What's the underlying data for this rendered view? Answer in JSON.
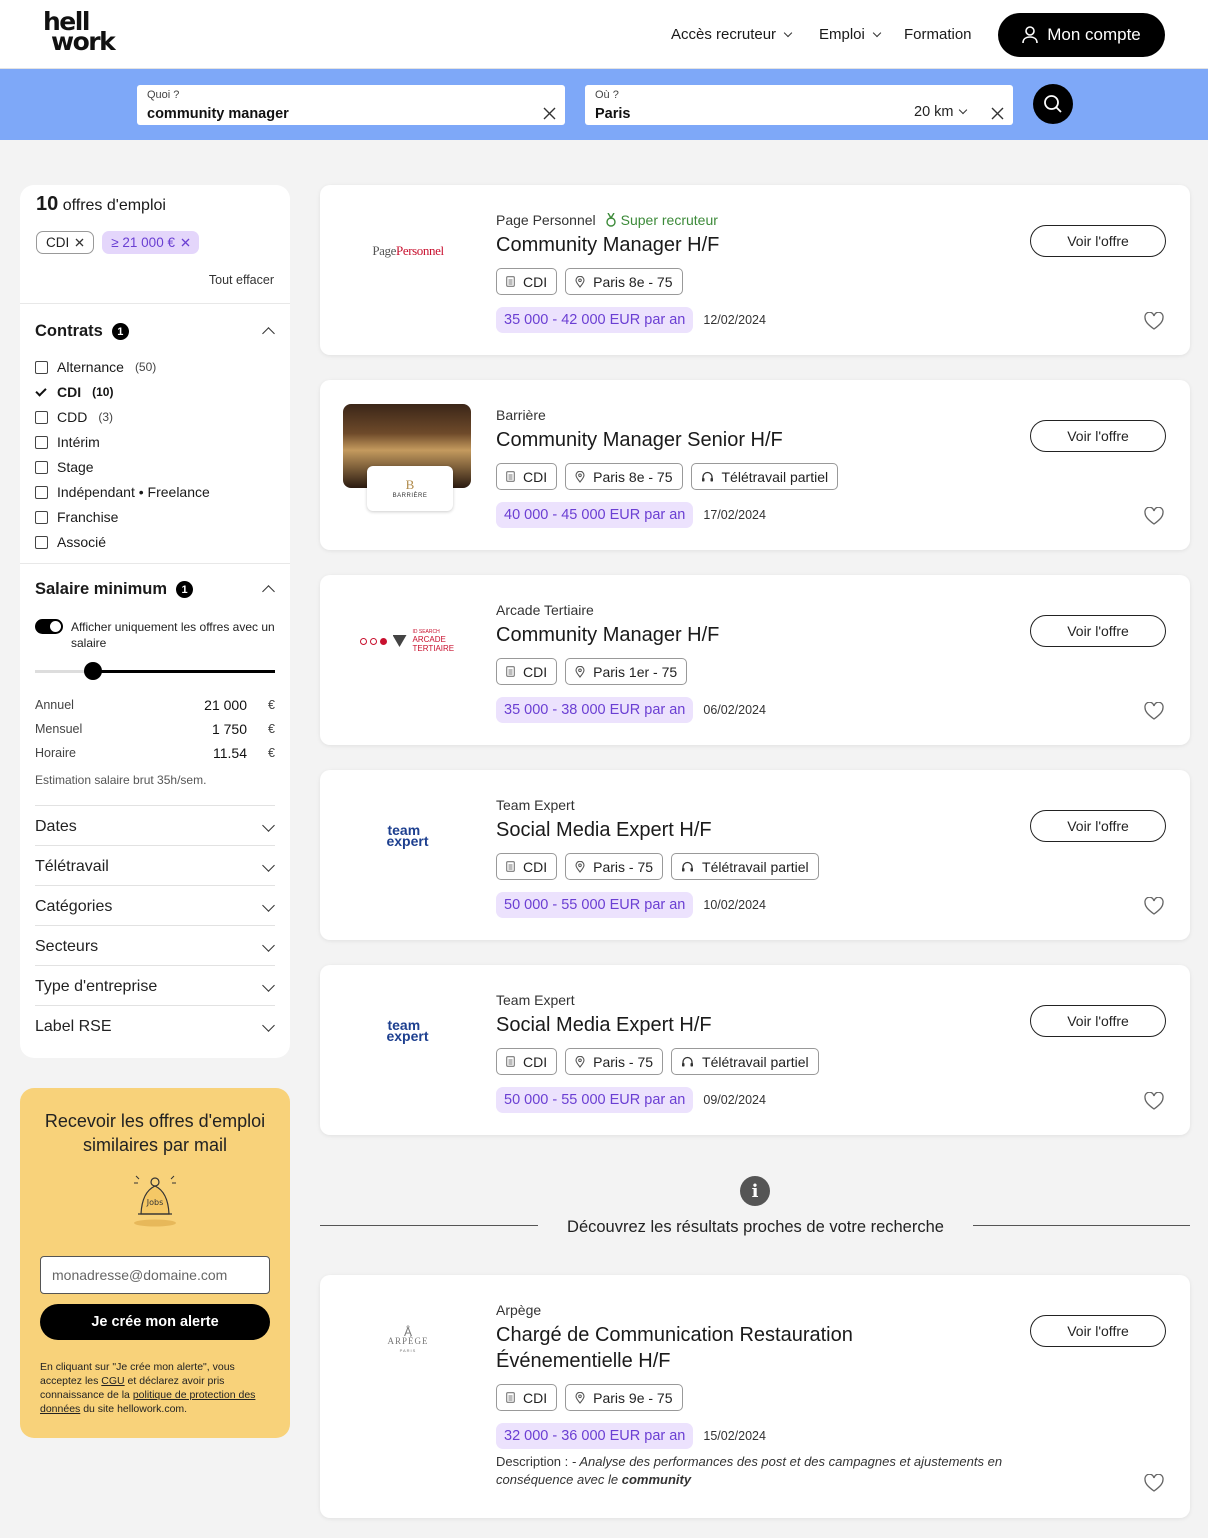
{
  "header": {
    "logo_line1": "hell",
    "logo_line2": "work",
    "nav": [
      {
        "label": "Accès recruteur",
        "dropdown": true
      },
      {
        "label": "Emploi",
        "dropdown": true
      },
      {
        "label": "Formation",
        "dropdown": false
      }
    ],
    "account_label": "Mon compte"
  },
  "search": {
    "what_label": "Quoi ?",
    "what_value": "community manager",
    "where_label": "Où ?",
    "where_value": "Paris",
    "radius": "20 km"
  },
  "sidebar": {
    "count": "10",
    "count_label": "offres d'emploi",
    "chips": [
      "CDI",
      "≥ 21 000 €"
    ],
    "clear_all": "Tout effacer",
    "contracts": {
      "title": "Contrats",
      "badge": "1",
      "options": [
        {
          "label": "Alternance",
          "count": "(50)",
          "checked": false
        },
        {
          "label": "CDI",
          "count": "(10)",
          "checked": true
        },
        {
          "label": "CDD",
          "count": "(3)",
          "checked": false
        },
        {
          "label": "Intérim",
          "count": "",
          "checked": false
        },
        {
          "label": "Stage",
          "count": "",
          "checked": false
        },
        {
          "label": "Indépendant • Freelance",
          "count": "",
          "checked": false
        },
        {
          "label": "Franchise",
          "count": "",
          "checked": false
        },
        {
          "label": "Associé",
          "count": "",
          "checked": false
        }
      ]
    },
    "salary": {
      "title": "Salaire minimum",
      "badge": "1",
      "toggle_label": "Afficher uniquement les offres avec un salaire",
      "toggle_on": true,
      "slider_level": 0.24,
      "rows": [
        {
          "label": "Annuel",
          "value": "21 000",
          "currency": "€"
        },
        {
          "label": "Mensuel",
          "value": "1 750",
          "currency": "€"
        },
        {
          "label": "Horaire",
          "value": "11.54",
          "currency": "€"
        }
      ],
      "estimate": "Estimation salaire brut 35h/sem."
    },
    "filters": [
      "Dates",
      "Télétravail",
      "Catégories",
      "Secteurs",
      "Type d'entreprise",
      "Label RSE"
    ]
  },
  "alert": {
    "title": "Recevoir les offres d'emploi similaires par mail",
    "icon_text": "Jobs",
    "email_placeholder": "monadresse@domaine.com",
    "button": "Je crée mon alerte",
    "legal_1": "En cliquant sur \"Je crée mon alerte\", vous acceptez les ",
    "legal_cgu": "CGU",
    "legal_2": " et déclarez avoir pris connaissance de la ",
    "legal_link": "politique de protection des données",
    "legal_3": " du site hellowork.com."
  },
  "jobs": [
    {
      "company": "Page Personnel",
      "super_recruiter": "Super recruteur",
      "logo": "PagePersonnel",
      "title": "Community Manager H/F",
      "contract": "CDI",
      "location": "Paris 8e - 75",
      "remote": "",
      "salary": "35 000 - 42 000 EUR par an",
      "date": "12/02/2024",
      "cta": "Voir l'offre"
    },
    {
      "company": "Barrière",
      "logo": "BARRIÈRE",
      "title": "Community Manager Senior H/F",
      "contract": "CDI",
      "location": "Paris 8e - 75",
      "remote": "Télétravail partiel",
      "salary": "40 000 - 45 000 EUR par an",
      "date": "17/02/2024",
      "cta": "Voir l'offre"
    },
    {
      "company": "Arcade Tertiaire",
      "logo": "ARCADE TERTIAIRE",
      "logo_small": "ID SEARCH",
      "title": "Community Manager H/F",
      "contract": "CDI",
      "location": "Paris 1er - 75",
      "remote": "",
      "salary": "35 000 - 38 000 EUR par an",
      "date": "06/02/2024",
      "cta": "Voir l'offre"
    },
    {
      "company": "Team Expert",
      "logo_line1": "team",
      "logo_line2": "expert",
      "title": "Social Media Expert H/F",
      "contract": "CDI",
      "location": "Paris - 75",
      "remote": "Télétravail partiel",
      "salary": "50 000 - 55 000 EUR par an",
      "date": "10/02/2024",
      "cta": "Voir l'offre"
    },
    {
      "company": "Team Expert",
      "logo_line1": "team",
      "logo_line2": "expert",
      "title": "Social Media Expert H/F",
      "contract": "CDI",
      "location": "Paris - 75",
      "remote": "Télétravail partiel",
      "salary": "50 000 - 55 000 EUR par an",
      "date": "09/02/2024",
      "cta": "Voir l'offre"
    }
  ],
  "nearby": {
    "info_icon": "i",
    "label": "Découvrez les résultats proches de votre recherche"
  },
  "nearby_job": {
    "company": "Arpège",
    "logo": "ARPÈGE",
    "logo_sub": "PARIS",
    "title": "Chargé de Communication Restauration Événementielle H/F",
    "contract": "CDI",
    "location": "Paris 9e - 75",
    "salary": "32 000 - 36 000 EUR par an",
    "date": "15/02/2024",
    "desc_label": "Description : ",
    "desc_text": "- Analyse des performances des post et des campagnes et ajustements en conséquence avec le ",
    "desc_bold": "community",
    "cta": "Voir l'offre"
  },
  "colors": {
    "accent": "#7ea8f8",
    "salary_bg": "#ece2fd",
    "salary_text": "#6b3fd3",
    "alert_bg": "#f8d27a",
    "super": "#3c8a39"
  }
}
